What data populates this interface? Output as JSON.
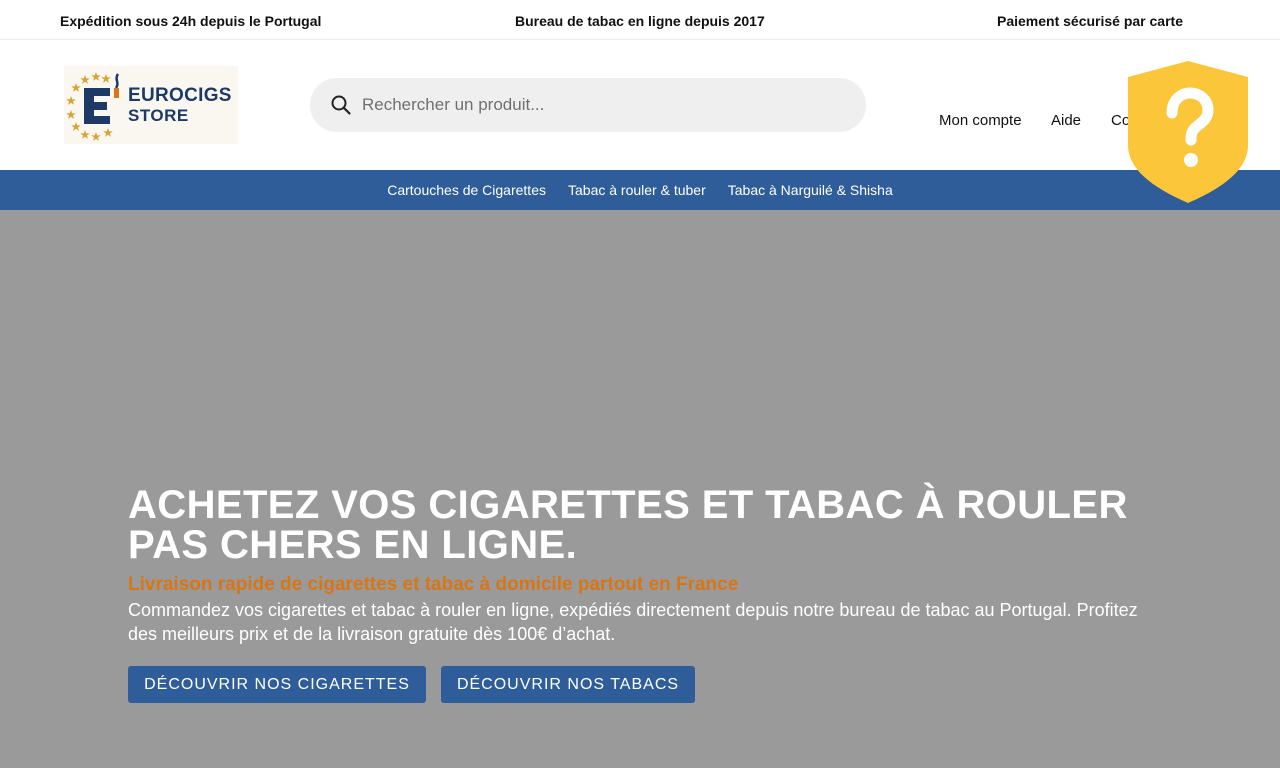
{
  "topbar": {
    "item1": "Expédition sous 24h depuis le Portugal",
    "item2": "Bureau de tabac en ligne depuis 2017",
    "item3": "Paiement sécurisé par carte"
  },
  "logo": {
    "brand_line1": "EUROCIGS",
    "brand_line2": "STORE",
    "icon": "eurocigs-logo-icon"
  },
  "search": {
    "placeholder": "Rechercher un produit...",
    "value": "",
    "icon": "search-icon"
  },
  "header_nav": {
    "account": "Mon compte",
    "help": "Aide",
    "contact": "Co"
  },
  "help_widget": {
    "icon": "shield-question-icon",
    "color": "#fcc63a"
  },
  "category_nav": {
    "items": [
      "Cartouches de Cigarettes",
      "Tabac à rouler & tuber",
      "Tabac à Narguilé & Shisha"
    ]
  },
  "hero": {
    "title": "ACHETEZ VOS CIGARETTES ET TABAC À ROULER PAS CHERS EN LIGNE.",
    "subtitle": "Livraison rapide de cigarettes et tabac à domicile partout en France",
    "text": "Commandez vos cigarettes et tabac à rouler en ligne, expédiés directement depuis notre bureau de tabac au Portugal. Profitez des meilleurs prix et de la livraison gratuite dès 100€ d’achat.",
    "button_cigarettes": "DÉCOUVRIR NOS CIGARETTES",
    "button_tabacs": "DÉCOUVRIR NOS TABACS"
  },
  "colors": {
    "brand_blue": "#2e5d99",
    "accent_orange": "#d87515",
    "hero_bg": "#9a9a9a",
    "help_yellow": "#fcc63a"
  }
}
